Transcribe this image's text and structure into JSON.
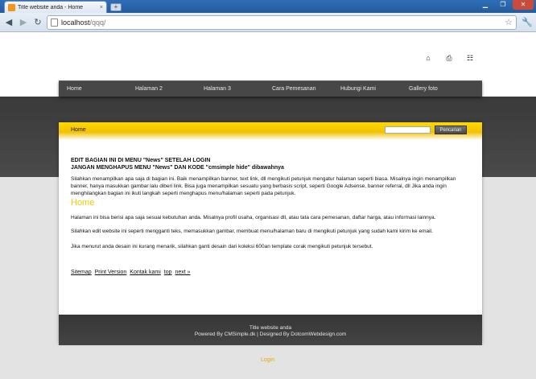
{
  "browser": {
    "tab_title": "Title website anda - Home",
    "tab_close": "×",
    "new_tab": "+",
    "url_host": "localhost",
    "url_path": "/qqq/"
  },
  "icons": {
    "back": "back-arrow-icon",
    "forward": "forward-arrow-icon",
    "reload": "reload-icon",
    "star": "bookmark-star-icon",
    "wrench": "wrench-icon",
    "home": "home-icon",
    "print": "print-icon",
    "sitemap": "sitemap-icon"
  },
  "menu": [
    "Home",
    "Halaman 2",
    "Halaman 3",
    "Cara Pemesanan",
    "Hubungi Kami",
    "Gallery foto"
  ],
  "breadcrumb": "Home",
  "search": {
    "button": "Pencarian",
    "value": ""
  },
  "content": {
    "edit_note_1": "EDIT BAGIAN INI DI MENU \"News\" SETELAH LOGIN",
    "edit_note_2": "JANGAN MENGHAPUS MENU \"News\" DAN KODE \"cmsimple hide\" dibawahnya",
    "banner_text": "Silahkan menampilkan apa saja di bagian ini. Baik menampilkan banner, text link, dll mengikuti petunjuk mengatur halaman seperti biasa. Misalnya ingin menampilkan banner, hanya masukkan gambar lalu diberi link. Bisa juga menampilkan sesuatu yang berbasis script, seperti Google Adsense, banner referral, dll Jika anda ingin menghilangkan bagian ini ikuti langkah seperti menghapus menu/halaman seperti pada petunjuk.",
    "heading": "Home",
    "p1": "Halaman ini bisa berisi apa saja sesuai kebutuhan anda. Misalnya profil usaha, organisasi dll, atau tata cara pemesanan, daftar harga, atau informasi lainnya.",
    "p2": "Silahkan edit website ini seperti mengganti teks, memasukkan gambar, membuat menu/halaman baru di mengikuti petunjuk yang sudah kami kirim ke email.",
    "p3": "Jika menurut anda desain ini kurang menarik, silahkan ganti desain dari koleksi 600an template corak mengikuti petunjuk tersebut."
  },
  "links": [
    "Sitemap",
    "Print Version",
    "Kontak kami",
    "top",
    "next »"
  ],
  "footer": {
    "line1": "Title website anda",
    "line2": "Powered By CMSimple.dk | Designed By DotcomWebdesign.com"
  },
  "login": "Login",
  "colors": {
    "accent": "#f2c800",
    "dark": "#474747"
  }
}
